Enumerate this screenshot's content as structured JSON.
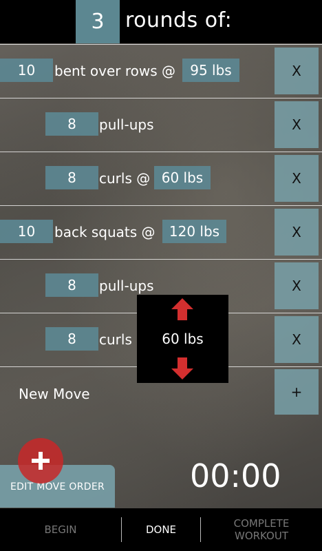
{
  "header": {
    "rounds_count": "3",
    "rounds_label": "rounds of:"
  },
  "moves": [
    {
      "reps": "10",
      "name": "bent over rows @",
      "weight": "95 lbs",
      "remove_label": "X"
    },
    {
      "reps": "8",
      "name": "pull-ups",
      "remove_label": "X"
    },
    {
      "reps": "8",
      "name": "curls @",
      "weight": "60 lbs",
      "remove_label": "X"
    },
    {
      "reps": "10",
      "name": "back squats @",
      "weight": "120 lbs",
      "remove_label": "X"
    },
    {
      "reps": "8",
      "name": "pull-ups",
      "remove_label": "X"
    },
    {
      "reps": "8",
      "name": "curls",
      "remove_label": "X"
    }
  ],
  "weight_picker": {
    "value": "60 lbs",
    "arrow_color": "#d32f2f"
  },
  "new_move": {
    "label": "New Move",
    "add_label": "+"
  },
  "edit_order_label": "EDIT MOVE ORDER",
  "timer": "00:00",
  "bottom_tabs": [
    {
      "label": "BEGIN",
      "active": false
    },
    {
      "label": "DONE",
      "active": true
    },
    {
      "label": "COMPLETE\nWORKOUT",
      "active": false
    }
  ],
  "colors": {
    "accent": "#5c8791",
    "button": "#78a0a8",
    "fab": "#c82828"
  }
}
